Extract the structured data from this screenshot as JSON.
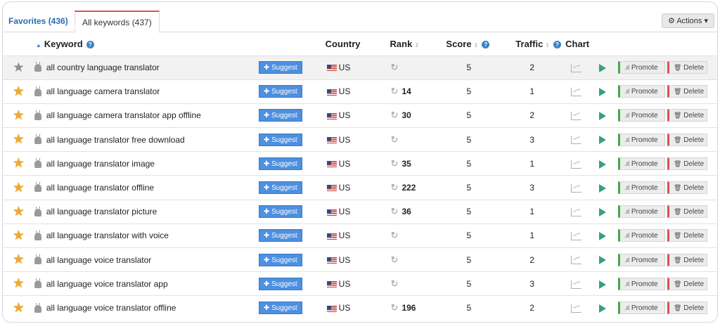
{
  "tabs": {
    "favorites": "Favorites (436)",
    "all_keywords": "All keywords (437)"
  },
  "actions_label": "Actions",
  "columns": {
    "keyword": "Keyword",
    "country": "Country",
    "rank": "Rank",
    "score": "Score",
    "traffic": "Traffic",
    "chart": "Chart"
  },
  "labels": {
    "suggest": "Suggest",
    "promote": "Promote",
    "delete": "Delete"
  },
  "rows": [
    {
      "favorite": false,
      "keyword": "all country language translator",
      "country": "US",
      "rank": "",
      "score": "5",
      "traffic": "2"
    },
    {
      "favorite": true,
      "keyword": "all language camera translator",
      "country": "US",
      "rank": "14",
      "score": "5",
      "traffic": "1"
    },
    {
      "favorite": true,
      "keyword": "all language camera translator app offline",
      "country": "US",
      "rank": "30",
      "score": "5",
      "traffic": "2"
    },
    {
      "favorite": true,
      "keyword": "all language translator free download",
      "country": "US",
      "rank": "",
      "score": "5",
      "traffic": "3"
    },
    {
      "favorite": true,
      "keyword": "all language translator image",
      "country": "US",
      "rank": "35",
      "score": "5",
      "traffic": "1"
    },
    {
      "favorite": true,
      "keyword": "all language translator offline",
      "country": "US",
      "rank": "222",
      "score": "5",
      "traffic": "3"
    },
    {
      "favorite": true,
      "keyword": "all language translator picture",
      "country": "US",
      "rank": "36",
      "score": "5",
      "traffic": "1"
    },
    {
      "favorite": true,
      "keyword": "all language translator with voice",
      "country": "US",
      "rank": "",
      "score": "5",
      "traffic": "1"
    },
    {
      "favorite": true,
      "keyword": "all language voice translator",
      "country": "US",
      "rank": "",
      "score": "5",
      "traffic": "2"
    },
    {
      "favorite": true,
      "keyword": "all language voice translator app",
      "country": "US",
      "rank": "",
      "score": "5",
      "traffic": "3"
    },
    {
      "favorite": true,
      "keyword": "all language voice translator offline",
      "country": "US",
      "rank": "196",
      "score": "5",
      "traffic": "2"
    }
  ]
}
